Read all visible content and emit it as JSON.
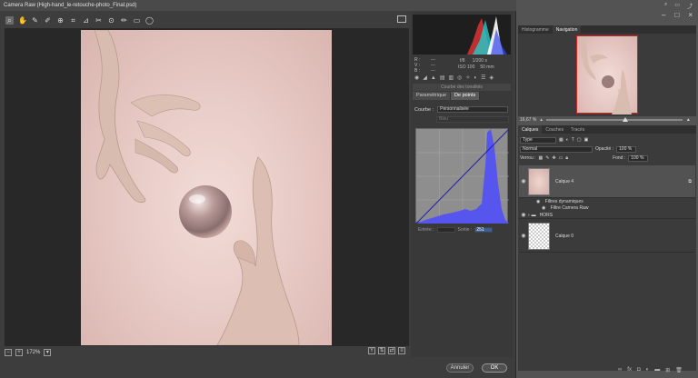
{
  "window": {
    "title": "Camera Raw (High-hand_le-retouche-photo_Final.psd)",
    "controls": [
      "–",
      "□",
      "×"
    ]
  },
  "toolbar": {
    "icons": [
      "zoom-icon",
      "hand-icon",
      "white-balance-icon",
      "color-sampler-icon",
      "targeted-adjust-icon",
      "crop-icon",
      "straighten-icon",
      "spot-removal-icon",
      "red-eye-icon",
      "adjustment-brush-icon",
      "graduated-filter-icon",
      "radial-filter-icon"
    ]
  },
  "bottom": {
    "zoom": "172%",
    "buttons": [
      "−",
      "+"
    ]
  },
  "info": {
    "rgb_labels": [
      "R :",
      "V :",
      "B :"
    ],
    "rgb_values": [
      "---",
      "---",
      "---"
    ],
    "exposure": [
      "f/8",
      "1/200 s"
    ],
    "iso_focal": [
      "ISO 100",
      "50 mm"
    ]
  },
  "panel": {
    "section_title": "Courbe des tonalités",
    "tabs": [
      "Paramétrique",
      "De points"
    ],
    "courbe_label": "Courbe :",
    "courbe_value": "Personnalisée",
    "canal_value": "Bleu",
    "entree_label": "Entrée :",
    "sortie_label": "Sortie :",
    "sortie_value": "251"
  },
  "footer": {
    "cancel": "Annuler",
    "ok": "OK"
  },
  "ps": {
    "nav_tabs": [
      "Histogramme",
      "Navigation"
    ],
    "nav_zoom": "16,67 %",
    "layers_tabs": [
      "Calques",
      "Couches",
      "Tracés"
    ],
    "filter_type": "Type",
    "blend_mode": "Normal",
    "opacity_label": "Opacité :",
    "opacity_value": "100 %",
    "lock_label": "Verrou :",
    "fill_label": "Fond :",
    "fill_value": "100 %",
    "layers": [
      {
        "name": "Calque 4"
      },
      {
        "name": "HORS"
      },
      {
        "name": "Calque 0"
      }
    ],
    "sub_layers": [
      "Filtres dynamiques",
      "Filtre Camera Raw"
    ]
  },
  "colors": {
    "accent_red": "#d22222",
    "selection_blue": "#3b5f98",
    "curve_line": "#2222aa"
  }
}
